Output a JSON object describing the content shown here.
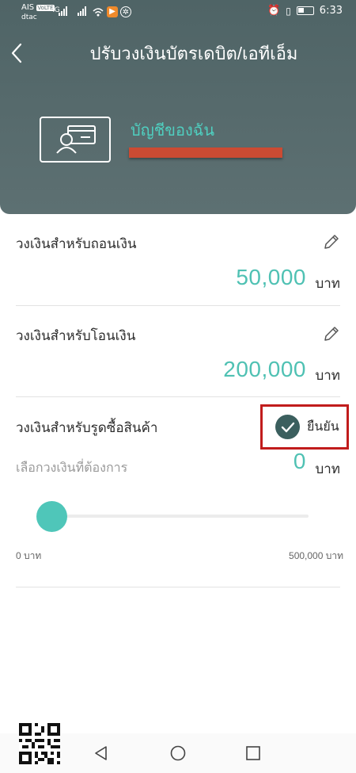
{
  "status_bar": {
    "carrier1": "AIS",
    "carrier1_badge": "VoLTE",
    "carrier2": "dtac",
    "network": "4G",
    "time": "6:33",
    "icons": [
      "signal-icon",
      "signal-icon",
      "wifi-icon",
      "app-notification-icon",
      "app-notification-icon",
      "alarm-icon",
      "vibrate-icon",
      "battery-icon"
    ]
  },
  "header": {
    "title": "ปรับวงเงินบัตรเดบิต/เอทีเอ็ม",
    "account_name": "บัญชีของฉัน"
  },
  "withdraw": {
    "label": "วงเงินสำหรับถอนเงิน",
    "amount": "50,000",
    "unit": "บาท"
  },
  "transfer": {
    "label": "วงเงินสำหรับโอนเงิน",
    "amount": "200,000",
    "unit": "บาท"
  },
  "purchase": {
    "label": "วงเงินสำหรับรูดซื้อสินค้า",
    "confirm_label": "ยืนยัน",
    "hint": "เลือกวงเงินที่ต้องการ",
    "amount": "0",
    "unit": "บาท",
    "slider_value_fraction": 0,
    "range_min": "0 บาท",
    "range_max": "500,000 บาท"
  },
  "colors": {
    "header_bg": "#566a6c",
    "accent": "#4fc1b3",
    "confirm_check": "#3b5f5e",
    "highlight_border": "#c11c1c",
    "redaction": "#cb4b33"
  }
}
